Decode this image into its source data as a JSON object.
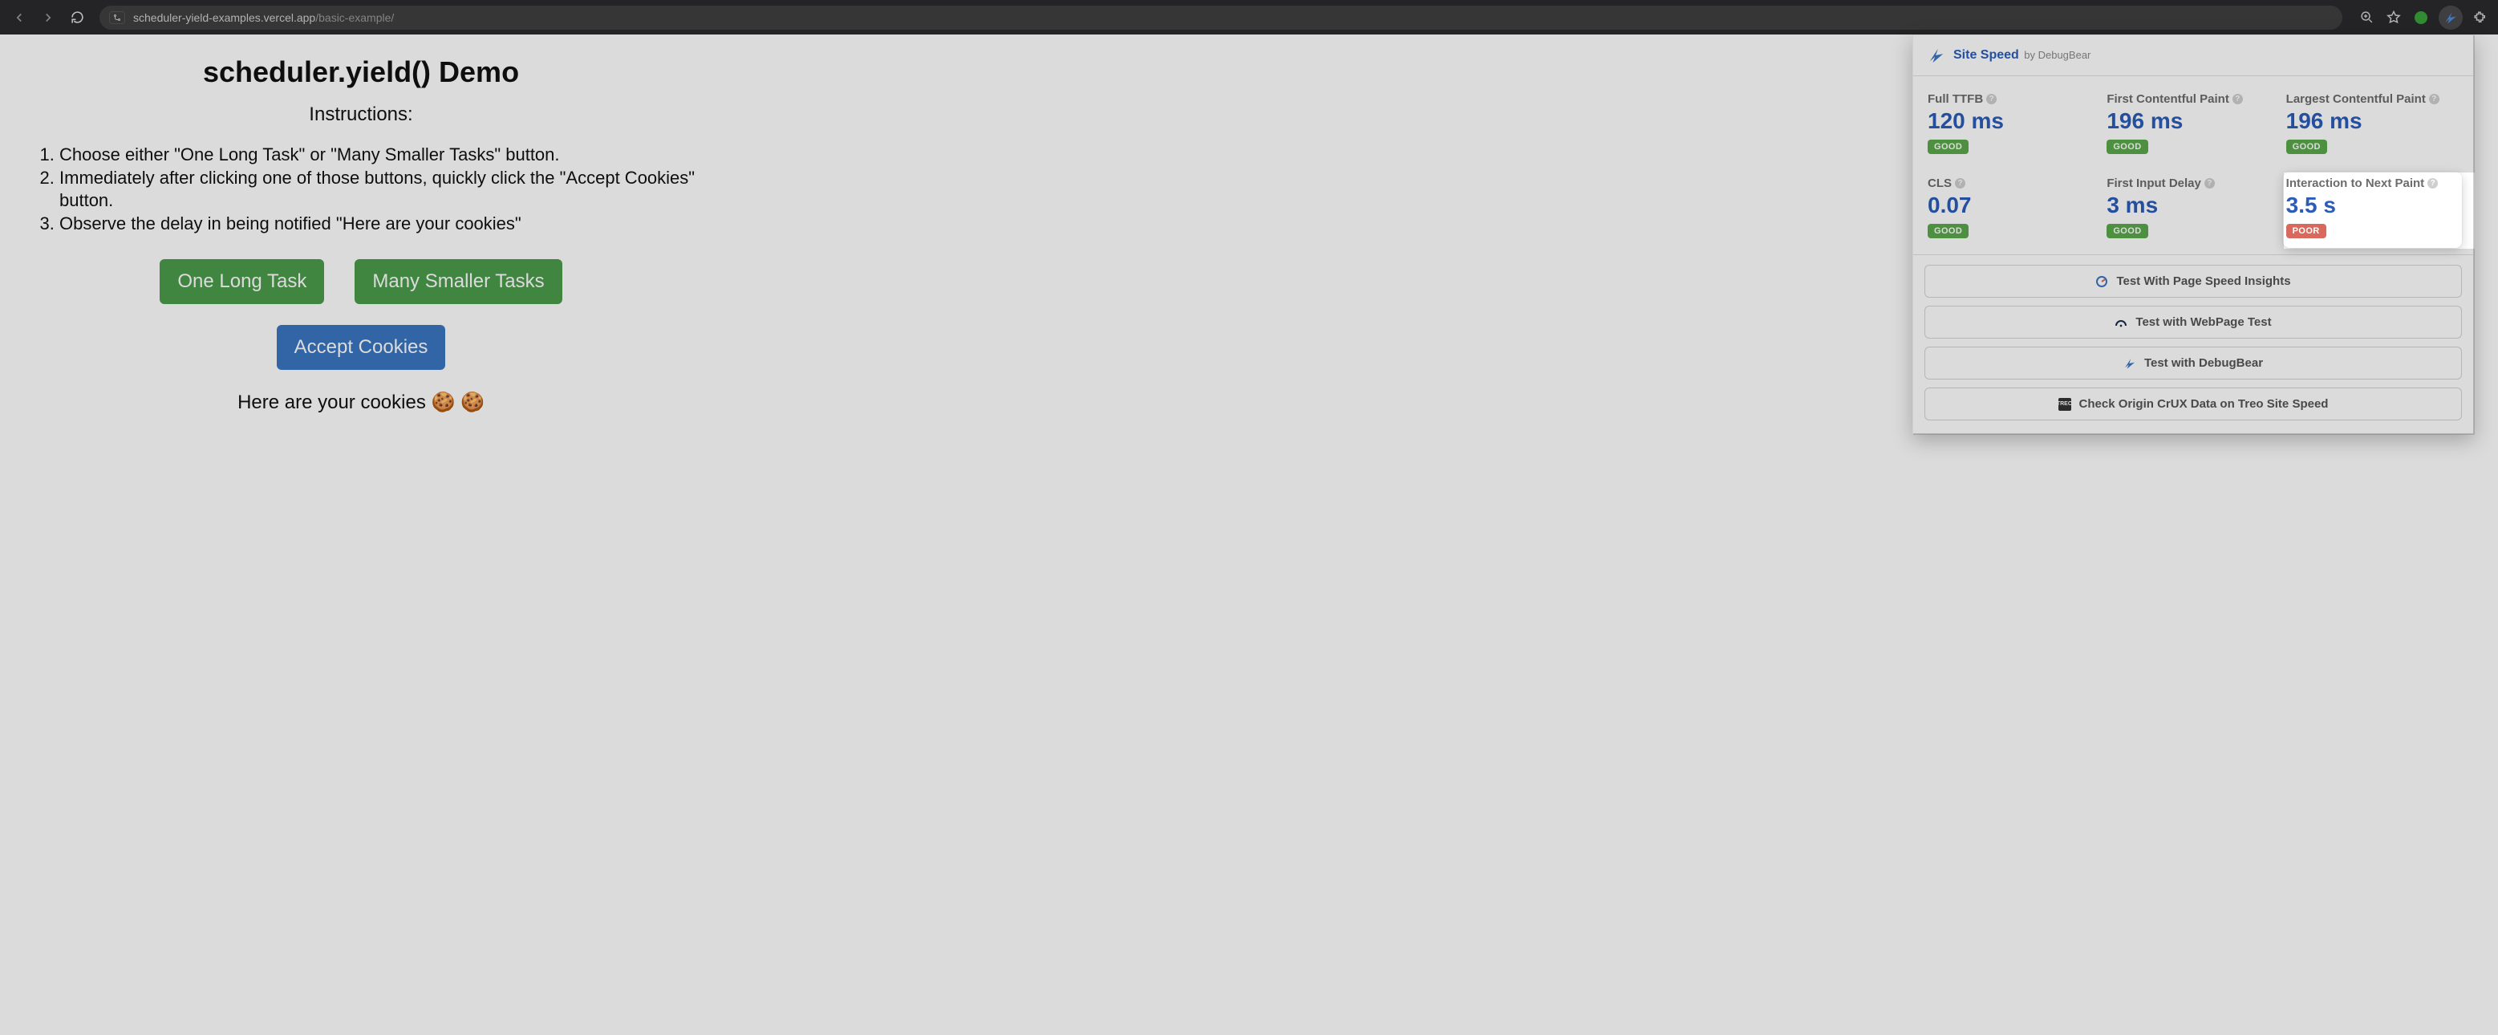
{
  "browser": {
    "url_host": "scheduler-yield-examples.vercel.app",
    "url_path": "/basic-example/"
  },
  "page": {
    "title": "scheduler.yield() Demo",
    "instructions_heading": "Instructions:",
    "instructions": [
      "Choose either \"One Long Task\" or \"Many Smaller Tasks\" button.",
      "Immediately after clicking one of those buttons, quickly click the \"Accept Cookies\" button.",
      "Observe the delay in being notified \"Here are your cookies\""
    ],
    "buttons": {
      "long_task": "One Long Task",
      "smaller_tasks": "Many Smaller Tasks",
      "accept_cookies": "Accept Cookies"
    },
    "result_text": "Here are your cookies 🍪 🍪"
  },
  "panel": {
    "title": "Site Speed",
    "subtitle": "by DebugBear",
    "metrics": [
      {
        "label": "Full TTFB",
        "value": "120 ms",
        "status": "GOOD",
        "status_class": "good",
        "highlight": false
      },
      {
        "label": "First Contentful Paint",
        "value": "196 ms",
        "status": "GOOD",
        "status_class": "good",
        "highlight": false
      },
      {
        "label": "Largest Contentful Paint",
        "value": "196 ms",
        "status": "GOOD",
        "status_class": "good",
        "highlight": false
      },
      {
        "label": "CLS",
        "value": "0.07",
        "status": "GOOD",
        "status_class": "good",
        "highlight": false
      },
      {
        "label": "First Input Delay",
        "value": "3 ms",
        "status": "GOOD",
        "status_class": "good",
        "highlight": false
      },
      {
        "label": "Interaction to Next Paint",
        "value": "3.5 s",
        "status": "POOR",
        "status_class": "poor",
        "highlight": true
      }
    ],
    "actions": [
      {
        "label": "Test With Page Speed Insights",
        "icon": "psi"
      },
      {
        "label": "Test with WebPage Test",
        "icon": "wpt"
      },
      {
        "label": "Test with DebugBear",
        "icon": "dbb"
      },
      {
        "label": "Check Origin CrUX Data on Treo Site Speed",
        "icon": "treo"
      }
    ]
  }
}
